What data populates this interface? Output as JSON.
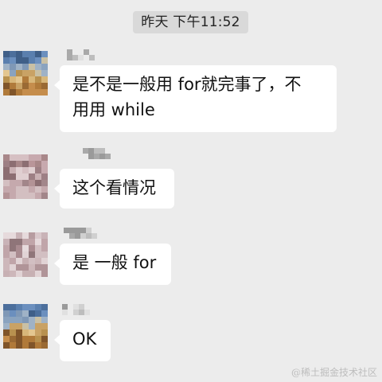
{
  "timestamp": "昨天 下午11:52",
  "messages": [
    {
      "text": "是不是一般用 for就完事了，不\n用用 while"
    },
    {
      "text": "这个看情况"
    },
    {
      "text": "是 一般 for"
    },
    {
      "text": "OK"
    }
  ],
  "watermark": "@稀土掘金技术社区",
  "colors": {
    "background": "#ececec",
    "bubble": "#ffffff",
    "timestamp_bg": "#d9d9d9"
  }
}
